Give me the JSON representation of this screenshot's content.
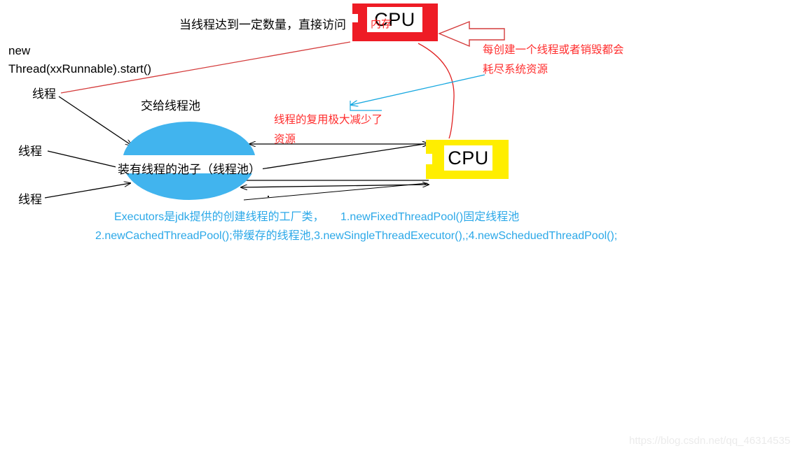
{
  "diagram": {
    "title_note_top": "当线程达到一定数量，直接访问",
    "new_thread_line1": "new",
    "new_thread_line2": "Thread(xxRunnable).start()",
    "thread_labels": [
      "线程",
      "线程",
      "线程"
    ],
    "hand_to_pool_label": "交给线程池",
    "pool_label": "装有线程的池子（线程池）",
    "cpu_top": {
      "inner_label": "CPU",
      "overlay_label": "内存",
      "fill_color": "#ee1c25"
    },
    "cpu_right": {
      "inner_label": "CPU",
      "fill_color": "#ffee00"
    },
    "red_note_right_line1": "每创建一个线程或者销毁都会",
    "red_note_right_line2": "耗尽系统资源",
    "red_note_mid_line1": "线程的复用极大减少了",
    "red_note_mid_line2": "资源",
    "blue_notes": {
      "line1_a": "Executors是jdk提供的创建线程的工厂类，",
      "line1_b": "1.newFixedThreadPool()固定线程池",
      "line2": "2.newCachedThreadPool();带缓存的线程池,3.newSingleThreadExecutor(),;4.newScheduedThreadPool();"
    },
    "watermark": "https://blog.csdn.net/qq_46314535",
    "colors": {
      "red": "#ff2d2d",
      "blue": "#2ba8e8",
      "pool_blue": "#41b4ee",
      "cpu_red": "#ee1c25",
      "cpu_yellow": "#ffee00",
      "black": "#000000"
    }
  }
}
